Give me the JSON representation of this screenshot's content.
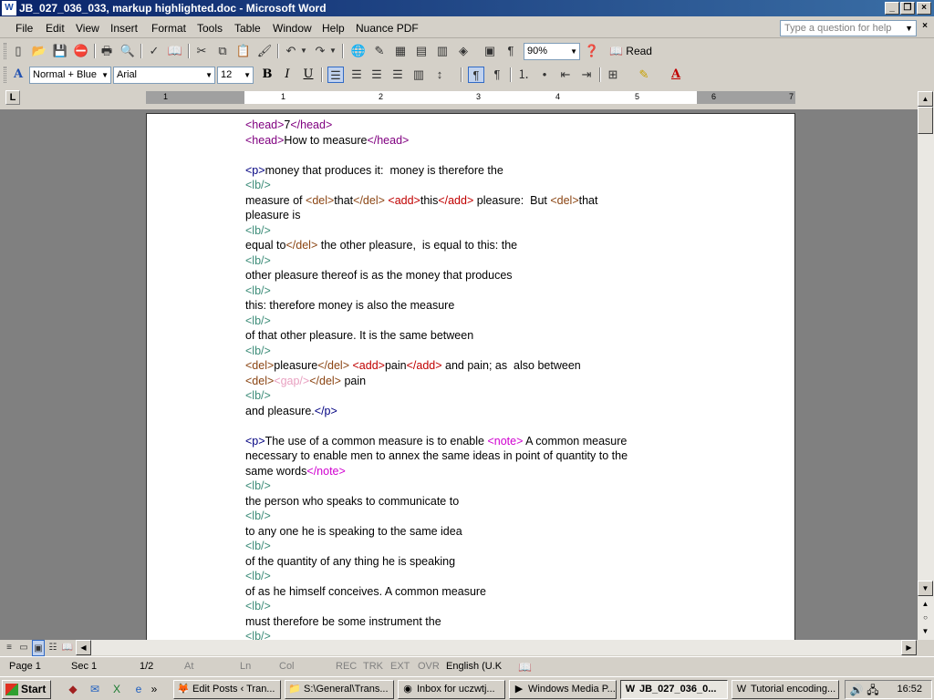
{
  "window": {
    "title": "JB_027_036_033, markup highlighted.doc - Microsoft Word"
  },
  "menu": [
    "File",
    "Edit",
    "View",
    "Insert",
    "Format",
    "Tools",
    "Table",
    "Window",
    "Help",
    "Nuance PDF"
  ],
  "help_box": {
    "placeholder": "Type a question for help"
  },
  "toolbar": {
    "zoom": "90%",
    "read_label": "Read"
  },
  "format": {
    "style": "Normal + Blue",
    "font": "Arial",
    "size": "12",
    "bold": "B",
    "italic": "I",
    "underline": "U"
  },
  "ruler": {
    "numbers": [
      "1",
      "1",
      "2",
      "3",
      "4",
      "5",
      "6",
      "7"
    ]
  },
  "document": {
    "lines": [
      [
        {
          "t": "<head>",
          "c": "head"
        },
        {
          "t": "7"
        },
        {
          "t": "</head>",
          "c": "head"
        }
      ],
      [
        {
          "t": "<head>",
          "c": "head"
        },
        {
          "t": "How to measure"
        },
        {
          "t": "</head>",
          "c": "head"
        }
      ],
      [],
      [
        {
          "t": "<p>",
          "c": "p"
        },
        {
          "t": "money that produces it:  money is therefore the"
        }
      ],
      [
        {
          "t": "<lb/>",
          "c": "lb"
        }
      ],
      [
        {
          "t": "measure of "
        },
        {
          "t": "<del>",
          "c": "del"
        },
        {
          "t": "that"
        },
        {
          "t": "</del>",
          "c": "del"
        },
        {
          "t": " "
        },
        {
          "t": "<add>",
          "c": "add"
        },
        {
          "t": "this"
        },
        {
          "t": "</add>",
          "c": "add"
        },
        {
          "t": " pleasure:  But "
        },
        {
          "t": "<del>",
          "c": "del"
        },
        {
          "t": "that"
        }
      ],
      [
        {
          "t": "pleasure is"
        }
      ],
      [
        {
          "t": "<lb/>",
          "c": "lb"
        }
      ],
      [
        {
          "t": "equal to"
        },
        {
          "t": "</del>",
          "c": "del"
        },
        {
          "t": " the other pleasure,  is equal to this: the"
        }
      ],
      [
        {
          "t": "<lb/>",
          "c": "lb"
        }
      ],
      [
        {
          "t": "other pleasure thereof is as the money that produces"
        }
      ],
      [
        {
          "t": "<lb/>",
          "c": "lb"
        }
      ],
      [
        {
          "t": "this: therefore money is also the measure"
        }
      ],
      [
        {
          "t": "<lb/>",
          "c": "lb"
        }
      ],
      [
        {
          "t": "of that other pleasure. It is the same between"
        }
      ],
      [
        {
          "t": "<lb/>",
          "c": "lb"
        }
      ],
      [
        {
          "t": "<del>",
          "c": "del"
        },
        {
          "t": "pleasure"
        },
        {
          "t": "</del>",
          "c": "del"
        },
        {
          "t": " "
        },
        {
          "t": "<add>",
          "c": "add"
        },
        {
          "t": "pain"
        },
        {
          "t": "</add>",
          "c": "add"
        },
        {
          "t": " and pain; as  also between"
        }
      ],
      [
        {
          "t": "<del>",
          "c": "del"
        },
        {
          "t": "<gap/>",
          "c": "gap"
        },
        {
          "t": "</del>",
          "c": "del"
        },
        {
          "t": " pain"
        }
      ],
      [
        {
          "t": "<lb/>",
          "c": "lb"
        }
      ],
      [
        {
          "t": "and pleasure."
        },
        {
          "t": "</p>",
          "c": "p"
        }
      ],
      [],
      [
        {
          "t": "<p>",
          "c": "p"
        },
        {
          "t": "The use of a common measure is to enable "
        },
        {
          "t": "<note>",
          "c": "note"
        },
        {
          "t": " A common measure"
        }
      ],
      [
        {
          "t": "necessary to enable men to annex the same ideas in point of quantity to the"
        }
      ],
      [
        {
          "t": "same words"
        },
        {
          "t": "</note>",
          "c": "note"
        }
      ],
      [
        {
          "t": "<lb/>",
          "c": "lb"
        }
      ],
      [
        {
          "t": "the person who speaks to communicate to"
        }
      ],
      [
        {
          "t": "<lb/>",
          "c": "lb"
        }
      ],
      [
        {
          "t": "to any one he is speaking to the same idea"
        }
      ],
      [
        {
          "t": "<lb/>",
          "c": "lb"
        }
      ],
      [
        {
          "t": "of the quantity of any thing he is speaking"
        }
      ],
      [
        {
          "t": "<lb/>",
          "c": "lb"
        }
      ],
      [
        {
          "t": "of as he himself conceives. A common measure"
        }
      ],
      [
        {
          "t": "<lb/>",
          "c": "lb"
        }
      ],
      [
        {
          "t": "must therefore be some instrument the"
        }
      ],
      [
        {
          "t": "<lb/>",
          "c": "lb"
        }
      ]
    ]
  },
  "status": {
    "page": "Page 1",
    "sec": "Sec 1",
    "pages": "1/2",
    "at": "At",
    "ln": "Ln",
    "col": "Col",
    "rec": "REC",
    "trk": "TRK",
    "ext": "EXT",
    "ovr": "OVR",
    "lang": "English (U.K"
  },
  "taskbar": {
    "start": "Start",
    "tasks": [
      "Edit Posts ‹ Tran...",
      "S:\\General\\Trans...",
      "Inbox for uczwtj...",
      "Windows Media P...",
      "JB_027_036_0...",
      "Tutorial encoding..."
    ],
    "active_index": 4,
    "clock": "16:52"
  }
}
